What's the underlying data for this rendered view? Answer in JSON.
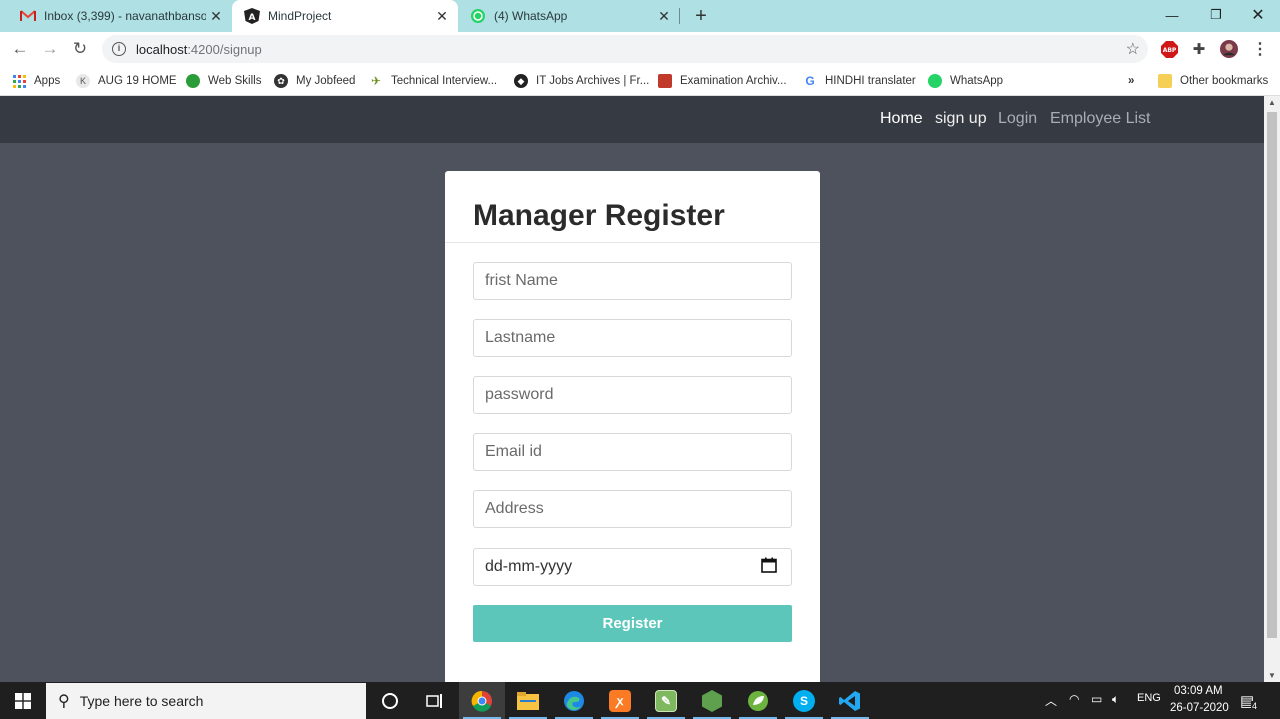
{
  "browser": {
    "tabs": [
      {
        "title": "Inbox (3,399) - navanathbansode",
        "icon": "gmail-icon",
        "active": false
      },
      {
        "title": "MindProject",
        "icon": "angular-icon",
        "active": true
      },
      {
        "title": "(4) WhatsApp",
        "icon": "whatsapp-icon",
        "active": false
      }
    ],
    "new_tab": "+",
    "url_host": "localhost",
    "url_path": ":4200/signup",
    "bookmarks": [
      {
        "label": "Apps",
        "icon": "apps-grid-icon"
      },
      {
        "label": "AUG 19 HOME",
        "icon": "k-icon"
      },
      {
        "label": "Web Skills",
        "icon": "web-skills-icon"
      },
      {
        "label": "My Jobfeed",
        "icon": "jobfeed-icon"
      },
      {
        "label": "Technical Interview...",
        "icon": "technical-icon"
      },
      {
        "label": "IT Jobs Archives | Fr...",
        "icon": "itjobs-icon"
      },
      {
        "label": "Examination Archiv...",
        "icon": "exam-icon"
      },
      {
        "label": "HINDHI translater",
        "icon": "google-icon"
      },
      {
        "label": "WhatsApp",
        "icon": "whatsapp-icon"
      }
    ],
    "more_bookmarks": "»",
    "other_bookmarks": "Other bookmarks"
  },
  "navbar": {
    "links": [
      "Home",
      "sign up",
      "Login",
      "Employee List"
    ]
  },
  "form": {
    "title": "Manager Register",
    "first_name_placeholder": "frist Name",
    "last_name_placeholder": "Lastname",
    "password_placeholder": "password",
    "email_placeholder": "Email id",
    "address_placeholder": "Address",
    "date_placeholder": "dd-mm-yyyy",
    "submit_label": "Register"
  },
  "taskbar": {
    "search_placeholder": "Type here to search",
    "language": "ENG",
    "time": "03:09 AM",
    "date": "26-07-2020",
    "notification_count": "4"
  },
  "colors": {
    "tab_strip": "#aee0e4",
    "navbar": "#363a42",
    "page_bg": "#4e525d",
    "register_button": "#5cc6bb"
  }
}
